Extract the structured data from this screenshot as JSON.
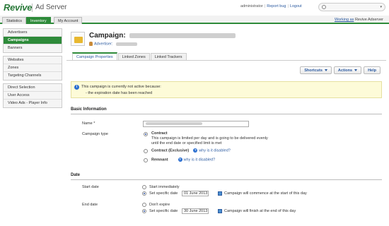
{
  "app": {
    "brand": "Revive",
    "product": "Ad Server"
  },
  "toplinks": {
    "user": "administrator",
    "report_bug": "Report bug",
    "logout": "Logout"
  },
  "tabs": [
    {
      "label": "Statistics"
    },
    {
      "label": "Inventory"
    },
    {
      "label": "My Account"
    }
  ],
  "working": {
    "prefix": "Working as",
    "account": "Revive Adserver"
  },
  "sidebar": {
    "groups": [
      [
        "Advertisers",
        "Campaigns",
        "Banners"
      ],
      [
        "Websites",
        "Zones",
        "Targeting Channels"
      ],
      [
        "Direct Selection",
        "User Access",
        "Video Ads - Player Info"
      ]
    ],
    "active": "Campaigns"
  },
  "campaign": {
    "title_prefix": "Campaign:",
    "advertiser_label": "Advertiser:"
  },
  "subtabs": [
    "Campaign Properties",
    "Linked Zones",
    "Linked Trackers"
  ],
  "actions": {
    "shortcuts": "Shortcuts",
    "actions": "Actions",
    "help": "Help"
  },
  "notice": {
    "line1": "This campaign is currently not active because:",
    "line2": "- the expiration date has been reached"
  },
  "basic": {
    "heading": "Basic Information",
    "name_label": "Name *",
    "type_label": "Campaign type",
    "contract_title": "Contract",
    "contract_desc1": "This campaign is limited per day and is going to be delivered evenly",
    "contract_desc2": "until the end date or specified limit is met",
    "exclusive_title": "Contract (Exclusive)",
    "why_disabled": "why is it disabled?",
    "remnant_title": "Remnant"
  },
  "date": {
    "heading": "Date",
    "start_label": "Start date",
    "start_immediately": "Start immediately",
    "set_specific": "Set specific date",
    "start_value": "01 June 2013",
    "start_note": "Campaign will commence at the start of this day",
    "end_label": "End date",
    "dont_expire": "Don't expire",
    "end_value": "30 June 2013",
    "end_note": "Campaign will finish at the end of this day"
  }
}
